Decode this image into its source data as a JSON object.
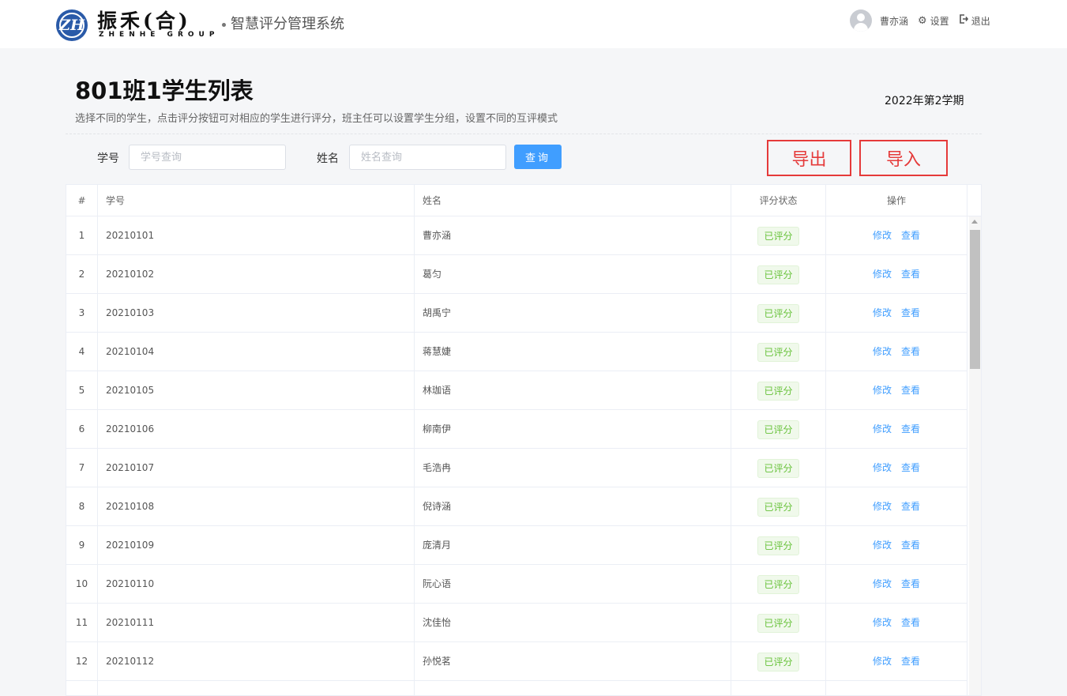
{
  "header": {
    "logo_text": "振禾(合)",
    "logo_subtext": "ZHENHE  GROUP",
    "system_title": "智慧评分管理系统",
    "user_name": "曹亦涵",
    "settings_label": "设置",
    "logout_label": "退出"
  },
  "page": {
    "title": "801班1学生列表",
    "description": "选择不同的学生，点击评分按钮可对相应的学生进行评分，班主任可以设置学生分组，设置不同的互评模式",
    "term": "2022年第2学期"
  },
  "filters": {
    "student_no_label": "学号",
    "student_no_placeholder": "学号查询",
    "name_label": "姓名",
    "name_placeholder": "姓名查询",
    "query_label": "查询",
    "export_label": "导出",
    "import_label": "导入"
  },
  "table": {
    "columns": [
      "#",
      "学号",
      "姓名",
      "评分状态",
      "操作"
    ],
    "edit_label": "修改",
    "view_label": "查看",
    "rows": [
      {
        "idx": "1",
        "no": "20210101",
        "name": "曹亦涵",
        "status": "已评分"
      },
      {
        "idx": "2",
        "no": "20210102",
        "name": "葛匀",
        "status": "已评分"
      },
      {
        "idx": "3",
        "no": "20210103",
        "name": "胡禹宁",
        "status": "已评分"
      },
      {
        "idx": "4",
        "no": "20210104",
        "name": "蒋慧婕",
        "status": "已评分"
      },
      {
        "idx": "5",
        "no": "20210105",
        "name": "林珈语",
        "status": "已评分"
      },
      {
        "idx": "6",
        "no": "20210106",
        "name": "柳南伊",
        "status": "已评分"
      },
      {
        "idx": "7",
        "no": "20210107",
        "name": "毛浩冉",
        "status": "已评分"
      },
      {
        "idx": "8",
        "no": "20210108",
        "name": "倪诗涵",
        "status": "已评分"
      },
      {
        "idx": "9",
        "no": "20210109",
        "name": "庞清月",
        "status": "已评分"
      },
      {
        "idx": "10",
        "no": "20210110",
        "name": "阮心语",
        "status": "已评分"
      },
      {
        "idx": "11",
        "no": "20210111",
        "name": "沈佳怡",
        "status": "已评分"
      },
      {
        "idx": "12",
        "no": "20210112",
        "name": "孙悦茗",
        "status": "已评分"
      }
    ]
  },
  "colors": {
    "primary": "#409eff",
    "success": "#67c23a",
    "annotation_red": "#e53a3a",
    "brand_blue": "#2a5aa8"
  },
  "icons": {
    "logo": "zh-logo-icon",
    "user": "user-avatar-icon",
    "settings": "gear-icon",
    "logout": "logout-icon",
    "scroll_up": "chevron-up-icon"
  }
}
